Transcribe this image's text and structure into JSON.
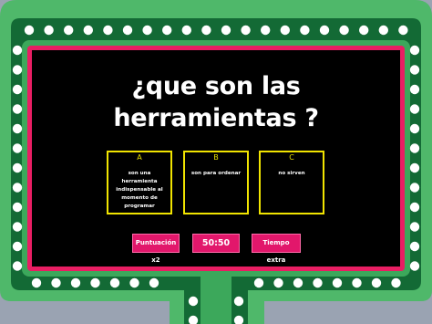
{
  "colors": {
    "outer_frame": "#4fb86a",
    "lights_band": "#136a35",
    "light_dot": "#ffffff",
    "inner_frame": "#e91e63",
    "panel": "#000000",
    "answer_border": "#f1e400",
    "button": "#e2176b"
  },
  "question": {
    "line1": "¿que son las",
    "line2": "herramientas ?"
  },
  "answers": [
    {
      "letter": "A",
      "text": "son una herramienta indispensable al momento de programar"
    },
    {
      "letter": "B",
      "text": "son para ordenar"
    },
    {
      "letter": "C",
      "text": "no sirven"
    }
  ],
  "controls": {
    "double_score_label": "Puntuación x2",
    "timer": "50:50",
    "extra_time_label": "Tiempo extra"
  }
}
